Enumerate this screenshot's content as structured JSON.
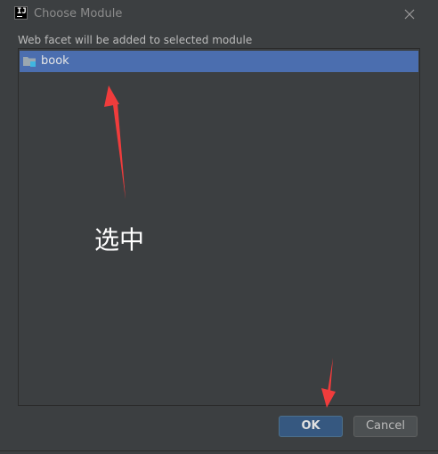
{
  "window": {
    "title": "Choose Module",
    "app_icon_text": "IJ"
  },
  "dialog": {
    "prompt": "Web facet will be added to selected module",
    "modules": [
      {
        "label": "book",
        "selected": true,
        "icon": "module-folder-icon"
      }
    ]
  },
  "annotation": {
    "text": "选中",
    "color": "#ffffff",
    "arrow_color": "#f03c3c"
  },
  "buttons": {
    "ok": "OK",
    "cancel": "Cancel"
  },
  "colors": {
    "background": "#3c3f41",
    "selection": "#4b6eaf",
    "ok_button": "#365880"
  }
}
